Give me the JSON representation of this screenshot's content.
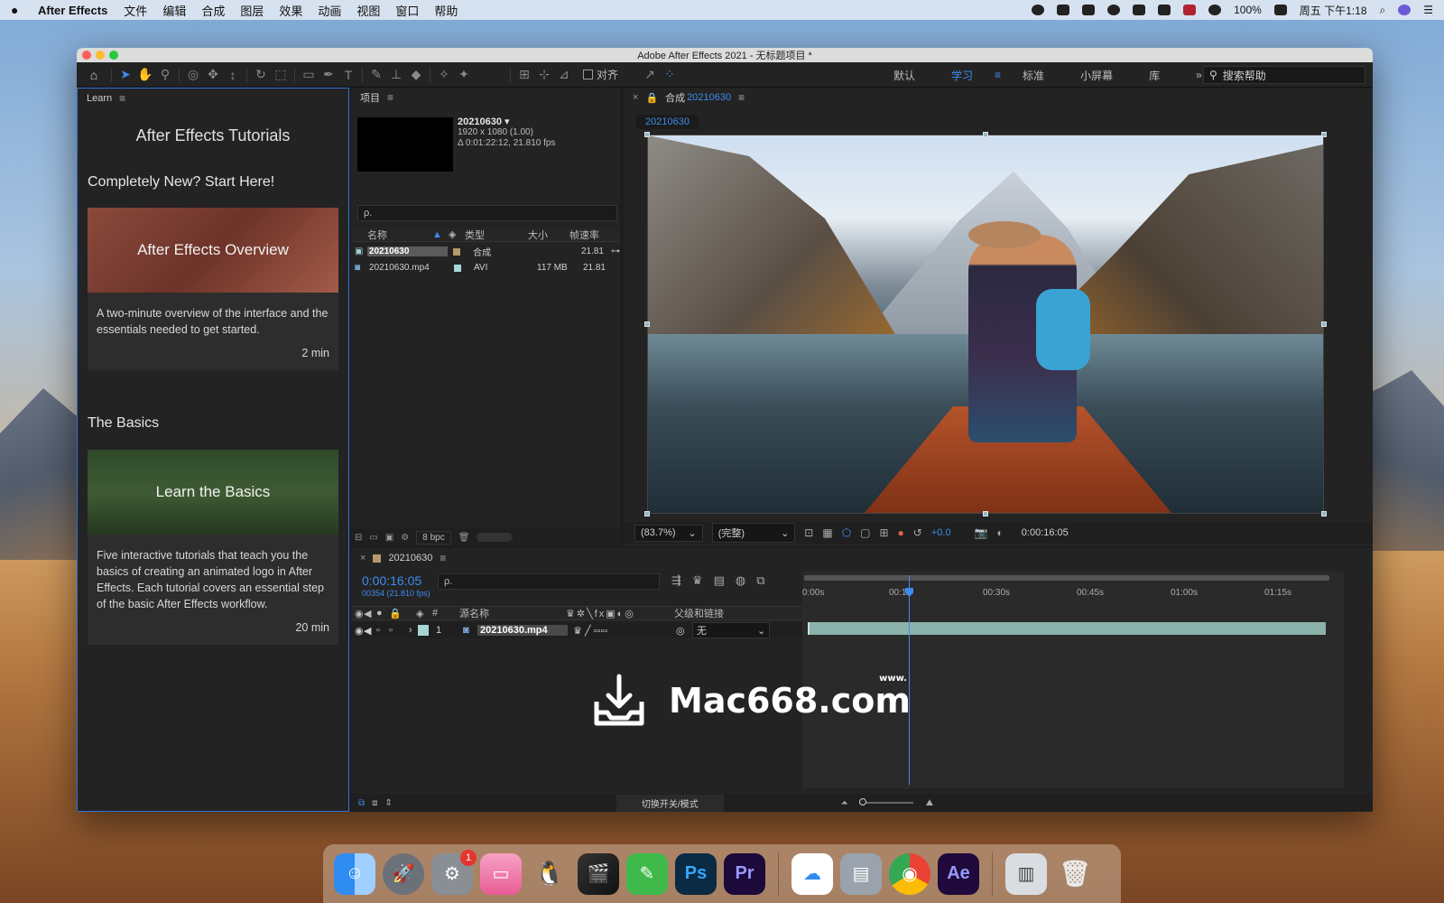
{
  "menubar": {
    "app_name": "After Effects",
    "items": [
      "文件",
      "编辑",
      "合成",
      "图层",
      "效果",
      "动画",
      "视图",
      "窗口",
      "帮助"
    ],
    "battery": "100%",
    "datetime": "周五 下午1:18"
  },
  "window": {
    "title": "Adobe After Effects 2021 - 无标题项目 *"
  },
  "toolbar": {
    "align_label": "对齐",
    "workspaces": [
      "默认",
      "学习",
      "标准",
      "小屏幕",
      "库"
    ],
    "active_workspace": "学习",
    "search_help": "搜索帮助"
  },
  "learn": {
    "panel_label": "Learn",
    "title": "After Effects Tutorials",
    "section1": "Completely New? Start Here!",
    "card1": {
      "title": "After Effects Overview",
      "desc": "A two-minute overview of the interface and the essentials needed to get started.",
      "duration": "2 min"
    },
    "section2": "The Basics",
    "card2": {
      "title": "Learn the Basics",
      "desc": "Five interactive tutorials that teach you the basics of creating an animated logo in After Effects. Each tutorial covers an essential step of the basic After Effects workflow.",
      "duration": "20 min"
    }
  },
  "project": {
    "panel_label": "项目",
    "selected": {
      "name": "20210630 ▾",
      "resolution": "1920 x 1080 (1.00)",
      "duration": "Δ 0:01:22:12, 21.810 fps"
    },
    "search_placeholder": "ρ.",
    "columns": {
      "name": "名称",
      "type": "类型",
      "size": "大小",
      "fps": "帧速率"
    },
    "rows": [
      {
        "name": "20210630",
        "type": "合成",
        "size": "",
        "fps": "21.81"
      },
      {
        "name": "20210630.mp4",
        "type": "AVI",
        "size": "117 MB",
        "fps": "21.81"
      }
    ],
    "bpc": "8 bpc"
  },
  "composition": {
    "panel_label": "合成",
    "comp_name": "20210630",
    "tab_label": "20210630",
    "zoom": "(83.7%)",
    "quality": "(完整)",
    "exposure": "+0.0",
    "timecode": "0:00:16:05"
  },
  "timeline": {
    "comp_name": "20210630",
    "timecode": "0:00:16:05",
    "subcode": "00354 (21.810 fps)",
    "search_placeholder": "ρ.",
    "columns": {
      "num": "#",
      "source": "源名称",
      "parent": "父级和链接"
    },
    "layer": {
      "num": "1",
      "name": "20210630.mp4",
      "parent": "无"
    },
    "ruler": [
      "0:00s",
      "00:1",
      "00:30s",
      "00:45s",
      "01:00s",
      "01:15s"
    ],
    "toggle_label": "切换开关/模式"
  },
  "watermark": {
    "text": "Mac668.com",
    "www": "www."
  },
  "dock": {
    "badge_count": "1",
    "apps": [
      "finder-icon",
      "launchpad-icon",
      "system-preferences-icon",
      "cleanmymac-icon",
      "qq-icon",
      "final-cut-icon",
      "pages-icon",
      "photoshop-icon",
      "premiere-icon",
      "baidu-netdisk-icon",
      "disk-utility-icon",
      "chrome-icon",
      "after-effects-icon",
      "preview-icon",
      "trash-icon"
    ],
    "ps_label": "Ps",
    "pr_label": "Pr",
    "ae_label": "Ae"
  }
}
